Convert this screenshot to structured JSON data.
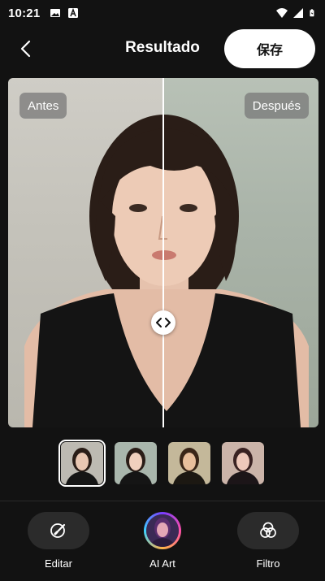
{
  "status_bar": {
    "time": "10:21",
    "left_icons": [
      "image-icon",
      "a-box-icon"
    ],
    "right_icons": [
      "wifi-icon",
      "signal-icon",
      "battery-icon"
    ]
  },
  "header": {
    "title": "Resultado",
    "save_label": "保存",
    "back_icon": "chevron-left-icon"
  },
  "compare": {
    "before_label": "Antes",
    "after_label": "Después",
    "handle_icon": "left-right-arrows-icon",
    "split_position": 0.5
  },
  "thumbnails": [
    {
      "name": "original",
      "selected": true
    },
    {
      "name": "style-2",
      "selected": false
    },
    {
      "name": "style-3",
      "selected": false
    },
    {
      "name": "style-4",
      "selected": false
    }
  ],
  "toolbar": {
    "edit_label": "Editar",
    "ai_art_label": "AI Art",
    "filter_label": "Filtro"
  },
  "colors": {
    "background": "#121212",
    "save_button_bg": "#ffffff",
    "tool_pill_bg": "#2b2b2b"
  }
}
